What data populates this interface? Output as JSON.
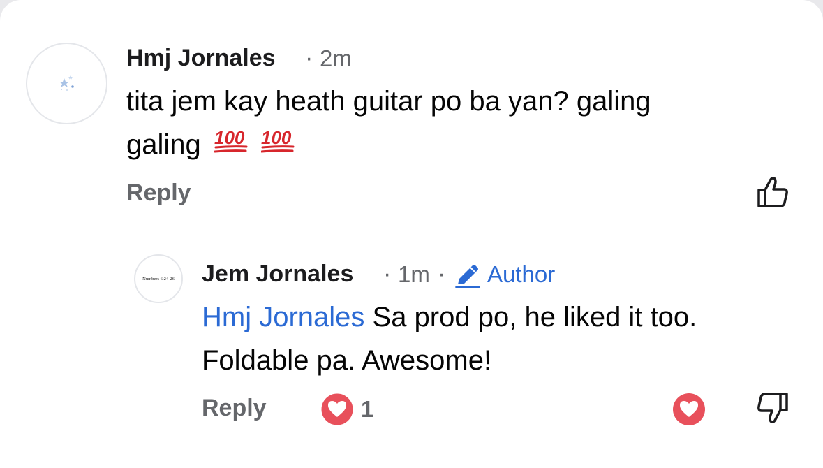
{
  "comment": {
    "author": "Hmj Jornales",
    "separator": "·",
    "time": "2m",
    "text_line1": "tita jem kay heath guitar po ba yan? galing",
    "text_line2": "galing",
    "emoji_names": [
      "hundred-points-emoji",
      "hundred-points-emoji"
    ],
    "reply_label": "Reply"
  },
  "reply": {
    "author": "Jem Jornales",
    "separator": "·",
    "time": "1m",
    "author_badge": "Author",
    "avatar_text": "Numbers 6:24-26",
    "mention": "Hmj Jornales",
    "text_line1": " Sa prod po, he liked it too.",
    "text_line2": "Foldable pa. Awesome!",
    "reply_label": "Reply",
    "reaction_count": "1"
  },
  "colors": {
    "accent_blue": "#2b6ad4",
    "heart_red": "#e8505b",
    "muted_text": "#65676b"
  }
}
